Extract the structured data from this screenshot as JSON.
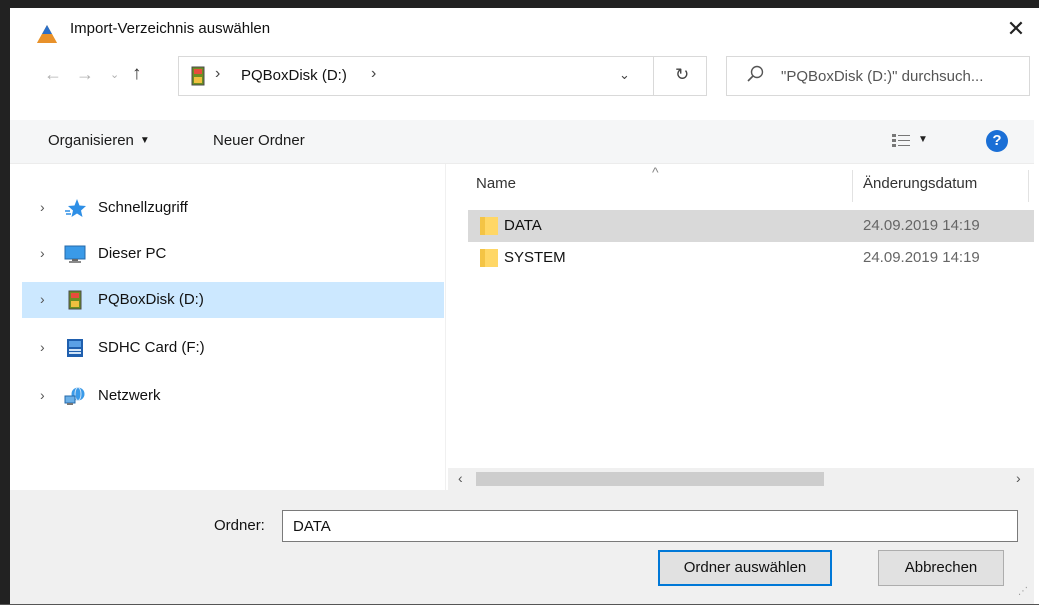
{
  "window": {
    "title": "Import-Verzeichnis auswählen",
    "close_glyph": "✕"
  },
  "nav": {
    "back_glyph": "←",
    "forward_glyph": "→",
    "history_glyph": "⌄",
    "up_glyph": "↑"
  },
  "address": {
    "separator": "›",
    "current": "PQBoxDisk (D:)",
    "dropdown_glyph": "⌄",
    "refresh_glyph": "↻"
  },
  "search": {
    "placeholder": "\"PQBoxDisk (D:)\" durchsuch..."
  },
  "toolbar": {
    "organize_label": "Organisieren",
    "caret": "▼",
    "new_folder_label": "Neuer Ordner",
    "help_glyph": "?"
  },
  "sidebar": {
    "chevron": "›",
    "items": [
      {
        "label": "Schnellzugriff",
        "icon": "star-icon"
      },
      {
        "label": "Dieser PC",
        "icon": "computer-icon"
      },
      {
        "label": "PQBoxDisk (D:)",
        "icon": "drive-icon"
      },
      {
        "label": "SDHC Card (F:)",
        "icon": "sdcard-icon"
      },
      {
        "label": "Netzwerk",
        "icon": "network-icon"
      }
    ],
    "selected_index": 2
  },
  "filelist": {
    "columns": {
      "name": "Name",
      "date": "Änderungsdatum"
    },
    "sort_arrow": "^",
    "rows": [
      {
        "name": "DATA",
        "date": "24.09.2019 14:19",
        "selected": true
      },
      {
        "name": "SYSTEM",
        "date": "24.09.2019 14:19",
        "selected": false
      }
    ],
    "scroll_left": "‹",
    "scroll_right": "›"
  },
  "footer": {
    "folder_label": "Ordner:",
    "folder_value": "DATA",
    "ok_label": "Ordner auswählen",
    "cancel_label": "Abbrechen"
  },
  "colors": {
    "accent": "#0078d7",
    "selection": "#cce8ff",
    "row_selected": "#d9d9d9",
    "folder": "#ffd766"
  }
}
